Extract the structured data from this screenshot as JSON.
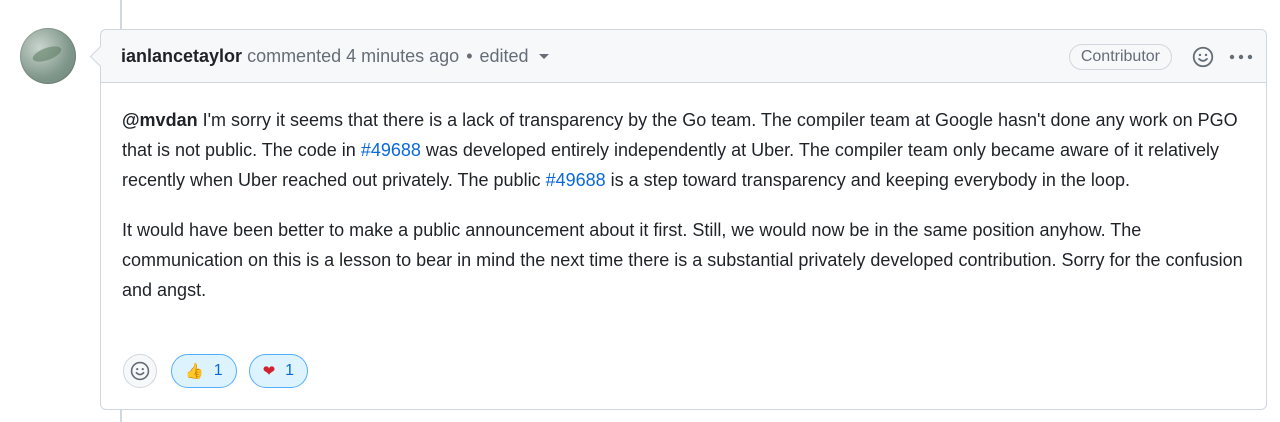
{
  "comment": {
    "author": "ianlancetaylor",
    "action_text": "commented",
    "timestamp": "4 minutes ago",
    "separator": "•",
    "edited_label": "edited",
    "role_badge": "Contributor",
    "body": {
      "p1": {
        "mention": "@mvdan",
        "text1": " I'm sorry it seems that there is a lack of transparency by the Go team. The compiler team at Google hasn't done any work on PGO that is not public. The code in ",
        "link1": "#49688",
        "text2": " was developed entirely independently at Uber. The compiler team only became aware of it relatively recently when Uber reached out privately. The public ",
        "link2": "#49688",
        "text3": " is a step toward transparency and keeping everybody in the loop."
      },
      "p2": "It would have been better to make a public announcement about it first. Still, we would now be in the same position anyhow. The communication on this is a lesson to bear in mind the next time there is a substantial privately developed contribution. Sorry for the confusion and angst."
    },
    "reactions": [
      {
        "emoji": "👍",
        "icon": "thumbs-up-icon",
        "count": "1"
      },
      {
        "emoji": "❤",
        "icon": "heart-icon",
        "count": "1"
      }
    ]
  },
  "colors": {
    "link": "#0969da",
    "reaction_bg": "#ddf4ff",
    "reaction_border": "#54aeff",
    "header_bg": "#f6f8fa",
    "border": "#d0d7de"
  },
  "icons": {
    "add_reaction": "smiley-icon",
    "header_reaction": "smiley-icon",
    "menu": "kebab-horizontal-icon",
    "edited_dropdown": "chevron-down-icon"
  }
}
